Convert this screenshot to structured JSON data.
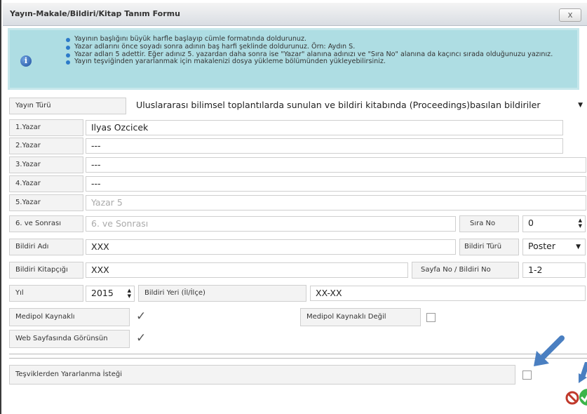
{
  "window": {
    "title": "Yayın-Makale/Bildiri/Kitap Tanım Formu",
    "close_label": "x"
  },
  "info": {
    "icon": "info-icon",
    "bullets": [
      "Yayının başlığını büyük harfle başlayıp cümle formatında doldurunuz.",
      "Yazar adlarını önce soyadı sonra adının baş harfi şeklinde doldurunuz. Örn: Aydın S.",
      "Yazar adları 5 adettir. Eğer adınız 5. yazardan daha sonra ise \"Yazar\" alanına adınızı ve \"Sıra No\" alanına da kaçıncı sırada olduğunuzu yazınız.",
      "Yayın teşviğinden yararlanmak için makalenizi dosya yükleme bölümünden yükleyebilirsiniz."
    ]
  },
  "form": {
    "yayin_turu": {
      "label": "Yayın Türü",
      "value": "Uluslararası bilimsel toplantılarda sunulan ve bildiri kitabında (Proceedings)basılan bildiriler"
    },
    "yazar1": {
      "label": "1.Yazar",
      "value": "Ilyas Ozcicek"
    },
    "yazar2": {
      "label": "2.Yazar",
      "value": "---"
    },
    "yazar3": {
      "label": "3.Yazar",
      "value": "---"
    },
    "yazar4": {
      "label": "4.Yazar",
      "value": "---"
    },
    "yazar5": {
      "label": "5.Yazar",
      "placeholder": "Yazar 5"
    },
    "yazar6": {
      "label": "6. ve Sonrası",
      "placeholder": "6. ve Sonrası"
    },
    "sira_no": {
      "label": "Sıra No",
      "value": "0"
    },
    "bildiri_adi": {
      "label": "Bildiri Adı",
      "value": "XXX"
    },
    "bildiri_turu": {
      "label": "Bildiri Türü",
      "value": "Poster"
    },
    "bildiri_kitapcigi": {
      "label": "Bildiri Kitapçığı",
      "value": "XXX"
    },
    "sayfa_no": {
      "label": "Sayfa No / Bildiri No",
      "value": "1-2"
    },
    "yil": {
      "label": "Yıl",
      "value": "2015"
    },
    "bildiri_yeri": {
      "label": "Bildiri Yeri (İl/İlçe)",
      "value": "XX-XX"
    },
    "medipol_kaynakli": {
      "label": "Medipol Kaynaklı",
      "checked": true
    },
    "medipol_kaynakli_degil": {
      "label": "Medipol Kaynaklı Değil",
      "checked": false
    },
    "web_sayfasinda": {
      "label": "Web Sayfasında Görünsün",
      "checked": true
    },
    "tesvik": {
      "label": "Teşviklerden Yararlanma İsteği",
      "checked": false
    }
  },
  "actions": {
    "cancel_icon": "no-entry-icon",
    "save_icon": "check-circle-icon"
  },
  "colors": {
    "info_bg": "#aedde3",
    "arrow": "#4a7fc1",
    "cancel": "#c0392b",
    "save": "#3cb44a"
  }
}
